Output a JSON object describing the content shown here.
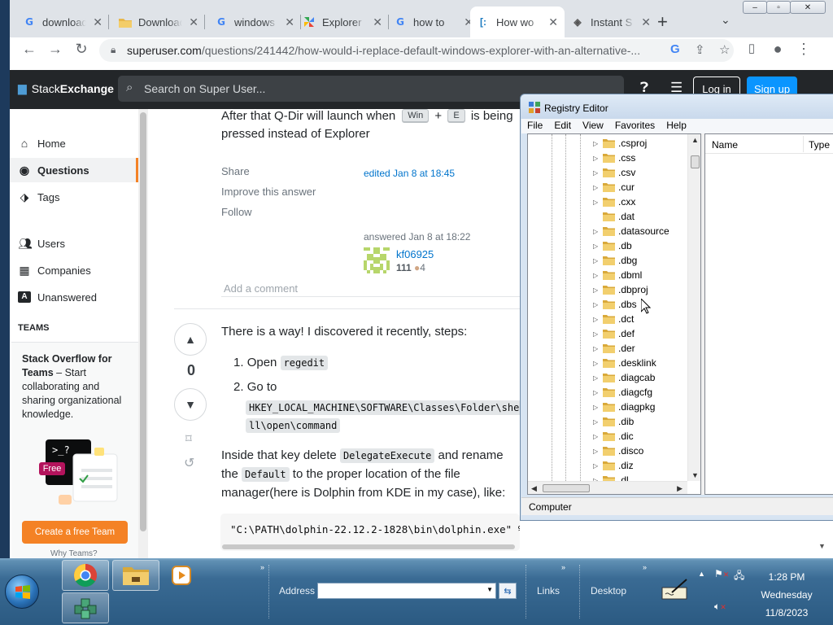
{
  "browser": {
    "tabs": [
      {
        "title": "download",
        "favicon": "google-g-icon"
      },
      {
        "title": "Downloads",
        "favicon": "folder-icon"
      },
      {
        "title": "windows",
        "favicon": "google-g-icon"
      },
      {
        "title": "Explorer",
        "favicon": "pinwheel-icon"
      },
      {
        "title": "how to",
        "favicon": "google-g-icon"
      },
      {
        "title": "How wo",
        "favicon": "superuser-icon",
        "active": true
      },
      {
        "title": "Instant S",
        "favicon": "instant-icon"
      }
    ],
    "new_tab_label": "+",
    "url_host": "superuser.com",
    "url_path": "/questions/241442/how-would-i-replace-default-windows-explorer-with-an-alternative-...",
    "window_buttons": [
      "–",
      "▫",
      "✕"
    ]
  },
  "stackexchange": {
    "logo_label_prefix": "Stack",
    "logo_label_bold": "Exchange",
    "search_placeholder": "Search on Super User...",
    "login_label": "Log in",
    "signup_label": "Sign up"
  },
  "leftnav": {
    "items": [
      {
        "label": "Home",
        "icon": "home-icon"
      },
      {
        "label": "Questions",
        "icon": "globe-icon",
        "active": true
      },
      {
        "label": "Tags",
        "icon": "tag-icon"
      },
      {
        "label": "Users",
        "icon": "users-icon"
      },
      {
        "label": "Companies",
        "icon": "building-icon"
      },
      {
        "label": "Unanswered",
        "icon": "unanswered-icon"
      }
    ],
    "teams_heading": "TEAMS",
    "teams_title": "Stack Overflow for Teams",
    "teams_text": " – Start collaborating and sharing organizational knowledge.",
    "teams_badge": "Free",
    "teams_prompt": ">_?",
    "create_team_label": "Create a free Team",
    "why_teams_label": "Why Teams?"
  },
  "answer1": {
    "line1_pre": "After that Q-Dir will launch when",
    "key1": "Win",
    "plus": "+",
    "key2": "E",
    "line1_post": "is being",
    "line2": "pressed instead of Explorer",
    "share": "Share",
    "improve": "Improve this answer",
    "follow": "Follow",
    "edited": "edited Jan 8 at 18:45",
    "answered": "answered Jan 8 at 18:22",
    "user_name": "kf06925",
    "user_rep": "111",
    "user_bronze": "4",
    "add_comment": "Add a comment"
  },
  "answer2": {
    "vote_count": "0",
    "intro": "There is a way! I discovered it recently, steps:",
    "step1_num": "1.",
    "step1_text": "Open",
    "step1_code": "regedit",
    "step2_num": "2.",
    "step2_text": "Go to",
    "step2_code_line1": "HKEY_LOCAL_MACHINE\\SOFTWARE\\Classes\\Folder\\she",
    "step2_code_line2": "ll\\open\\command",
    "p1_pre": "Inside that key delete",
    "p1_code": "DelegateExecute",
    "p1_post": "and rename",
    "p2_pre": "the",
    "p2_code": "Default",
    "p2_post": "to the proper location of the file",
    "p3": "manager(here is Dolphin from KDE in my case), like:",
    "code_block": "\"C:\\PATH\\dolphin-22.12.2-1828\\bin\\dolphin.exe\" %1"
  },
  "regedit": {
    "title": "Registry Editor",
    "menu": [
      "File",
      "Edit",
      "View",
      "Favorites",
      "Help"
    ],
    "tree_items": [
      {
        "name": ".csproj",
        "expandable": true
      },
      {
        "name": ".css",
        "expandable": true
      },
      {
        "name": ".csv",
        "expandable": true
      },
      {
        "name": ".cur",
        "expandable": true
      },
      {
        "name": ".cxx",
        "expandable": true
      },
      {
        "name": ".dat",
        "expandable": false
      },
      {
        "name": ".datasource",
        "expandable": true
      },
      {
        "name": ".db",
        "expandable": true
      },
      {
        "name": ".dbg",
        "expandable": true
      },
      {
        "name": ".dbml",
        "expandable": true
      },
      {
        "name": ".dbproj",
        "expandable": true
      },
      {
        "name": ".dbs",
        "expandable": true
      },
      {
        "name": ".dct",
        "expandable": true
      },
      {
        "name": ".def",
        "expandable": true
      },
      {
        "name": ".der",
        "expandable": true
      },
      {
        "name": ".desklink",
        "expandable": true
      },
      {
        "name": ".diagcab",
        "expandable": true
      },
      {
        "name": ".diagcfg",
        "expandable": true
      },
      {
        "name": ".diagpkg",
        "expandable": true
      },
      {
        "name": ".dib",
        "expandable": true
      },
      {
        "name": ".dic",
        "expandable": true
      },
      {
        "name": ".disco",
        "expandable": true
      },
      {
        "name": ".diz",
        "expandable": true
      },
      {
        "name": ".dl",
        "expandable": true
      }
    ],
    "col_name": "Name",
    "col_type": "Type",
    "status": "Computer"
  },
  "taskbar": {
    "address_label": "Address",
    "address_value": "",
    "links_label": "Links",
    "desktop_label": "Desktop",
    "time": "1:28 PM",
    "day": "Wednesday",
    "date": "11/8/2023"
  }
}
